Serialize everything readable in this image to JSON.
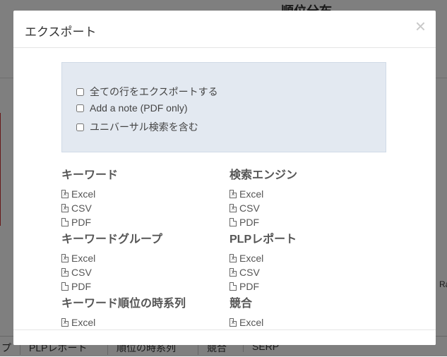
{
  "background": {
    "title": "順位分布",
    "right_label": "Ra",
    "tabs": [
      "プ",
      "PLPレポート",
      "順位の時系列",
      "競合",
      "SERP"
    ]
  },
  "modal": {
    "title": "エクスポート",
    "close_symbol": "×",
    "options": [
      {
        "label": "全ての行をエクスポートする",
        "checked": false
      },
      {
        "label": "Add a note (PDF only)",
        "checked": false
      },
      {
        "label": "ユニバーサル検索を含む",
        "checked": false
      }
    ],
    "sections": [
      {
        "title": "キーワード",
        "links": [
          "Excel",
          "CSV",
          "PDF"
        ]
      },
      {
        "title": "検索エンジン",
        "links": [
          "Excel",
          "CSV",
          "PDF"
        ]
      },
      {
        "title": "キーワードグループ",
        "links": [
          "Excel",
          "CSV",
          "PDF"
        ]
      },
      {
        "title": "PLPレポート",
        "links": [
          "Excel",
          "CSV",
          "PDF"
        ]
      },
      {
        "title": "キーワード順位の時系列",
        "links": [
          "Excel"
        ]
      },
      {
        "title": "競合",
        "links": [
          "Excel"
        ]
      }
    ],
    "icons": {
      "excel": "excel-file-icon",
      "csv": "csv-file-icon",
      "pdf": "pdf-file-icon"
    }
  }
}
